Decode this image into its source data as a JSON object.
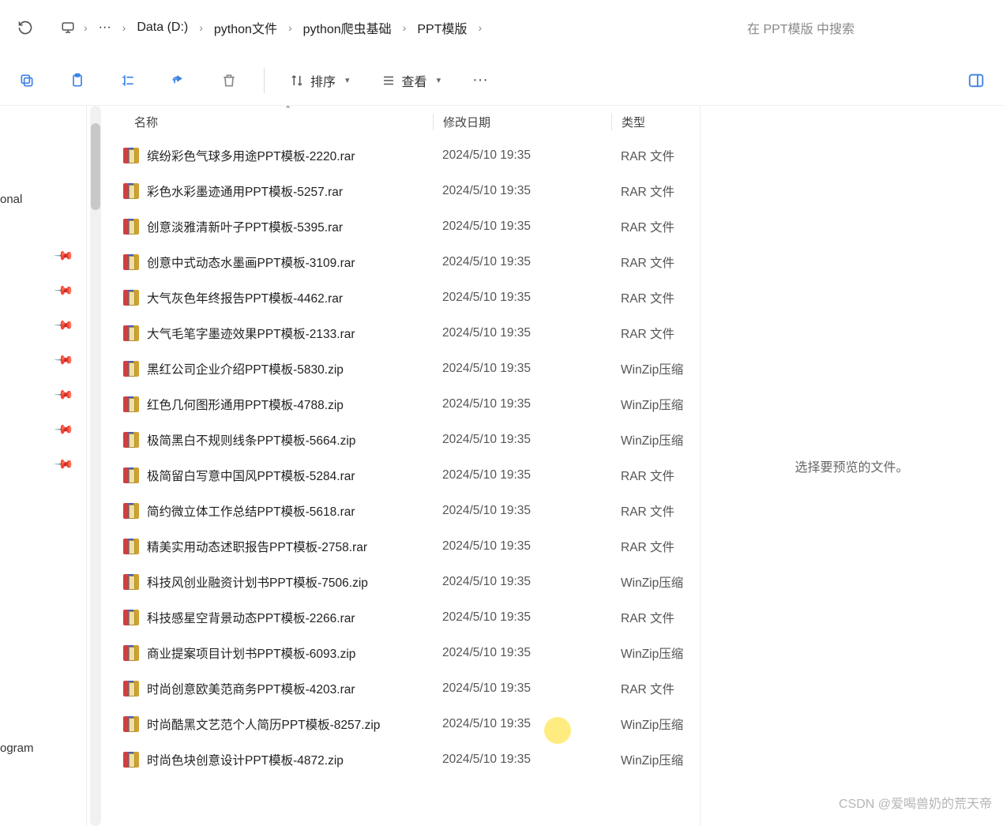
{
  "breadcrumb": {
    "items": [
      "Data (D:)",
      "python文件",
      "python爬虫基础",
      "PPT模版"
    ]
  },
  "search": {
    "placeholder": "在 PPT模版 中搜索"
  },
  "toolbar": {
    "sort_label": "排序",
    "view_label": "查看"
  },
  "nav": {
    "top_text": "onal",
    "bot_text": "ogram"
  },
  "columns": {
    "name": "名称",
    "date": "修改日期",
    "type": "类型"
  },
  "files": [
    {
      "name": "缤纷彩色气球多用途PPT模板-2220.rar",
      "date": "2024/5/10 19:35",
      "type": "RAR 文件"
    },
    {
      "name": "彩色水彩墨迹通用PPT模板-5257.rar",
      "date": "2024/5/10 19:35",
      "type": "RAR 文件"
    },
    {
      "name": "创意淡雅清新叶子PPT模板-5395.rar",
      "date": "2024/5/10 19:35",
      "type": "RAR 文件"
    },
    {
      "name": "创意中式动态水墨画PPT模板-3109.rar",
      "date": "2024/5/10 19:35",
      "type": "RAR 文件"
    },
    {
      "name": "大气灰色年终报告PPT模板-4462.rar",
      "date": "2024/5/10 19:35",
      "type": "RAR 文件"
    },
    {
      "name": "大气毛笔字墨迹效果PPT模板-2133.rar",
      "date": "2024/5/10 19:35",
      "type": "RAR 文件"
    },
    {
      "name": "黑红公司企业介绍PPT模板-5830.zip",
      "date": "2024/5/10 19:35",
      "type": "WinZip压缩"
    },
    {
      "name": "红色几何图形通用PPT模板-4788.zip",
      "date": "2024/5/10 19:35",
      "type": "WinZip压缩"
    },
    {
      "name": "极简黑白不规则线条PPT模板-5664.zip",
      "date": "2024/5/10 19:35",
      "type": "WinZip压缩"
    },
    {
      "name": "极简留白写意中国风PPT模板-5284.rar",
      "date": "2024/5/10 19:35",
      "type": "RAR 文件"
    },
    {
      "name": "简约微立体工作总结PPT模板-5618.rar",
      "date": "2024/5/10 19:35",
      "type": "RAR 文件"
    },
    {
      "name": "精美实用动态述职报告PPT模板-2758.rar",
      "date": "2024/5/10 19:35",
      "type": "RAR 文件"
    },
    {
      "name": "科技风创业融资计划书PPT模板-7506.zip",
      "date": "2024/5/10 19:35",
      "type": "WinZip压缩"
    },
    {
      "name": "科技感星空背景动态PPT模板-2266.rar",
      "date": "2024/5/10 19:35",
      "type": "RAR 文件"
    },
    {
      "name": "商业提案项目计划书PPT模板-6093.zip",
      "date": "2024/5/10 19:35",
      "type": "WinZip压缩"
    },
    {
      "name": "时尚创意欧美范商务PPT模板-4203.rar",
      "date": "2024/5/10 19:35",
      "type": "RAR 文件"
    },
    {
      "name": "时尚酷黑文艺范个人简历PPT模板-8257.zip",
      "date": "2024/5/10 19:35",
      "type": "WinZip压缩"
    },
    {
      "name": "时尚色块创意设计PPT模板-4872.zip",
      "date": "2024/5/10 19:35",
      "type": "WinZip压缩"
    }
  ],
  "preview": {
    "empty_text": "选择要预览的文件。"
  },
  "watermark": "CSDN @爱喝兽奶的荒天帝"
}
